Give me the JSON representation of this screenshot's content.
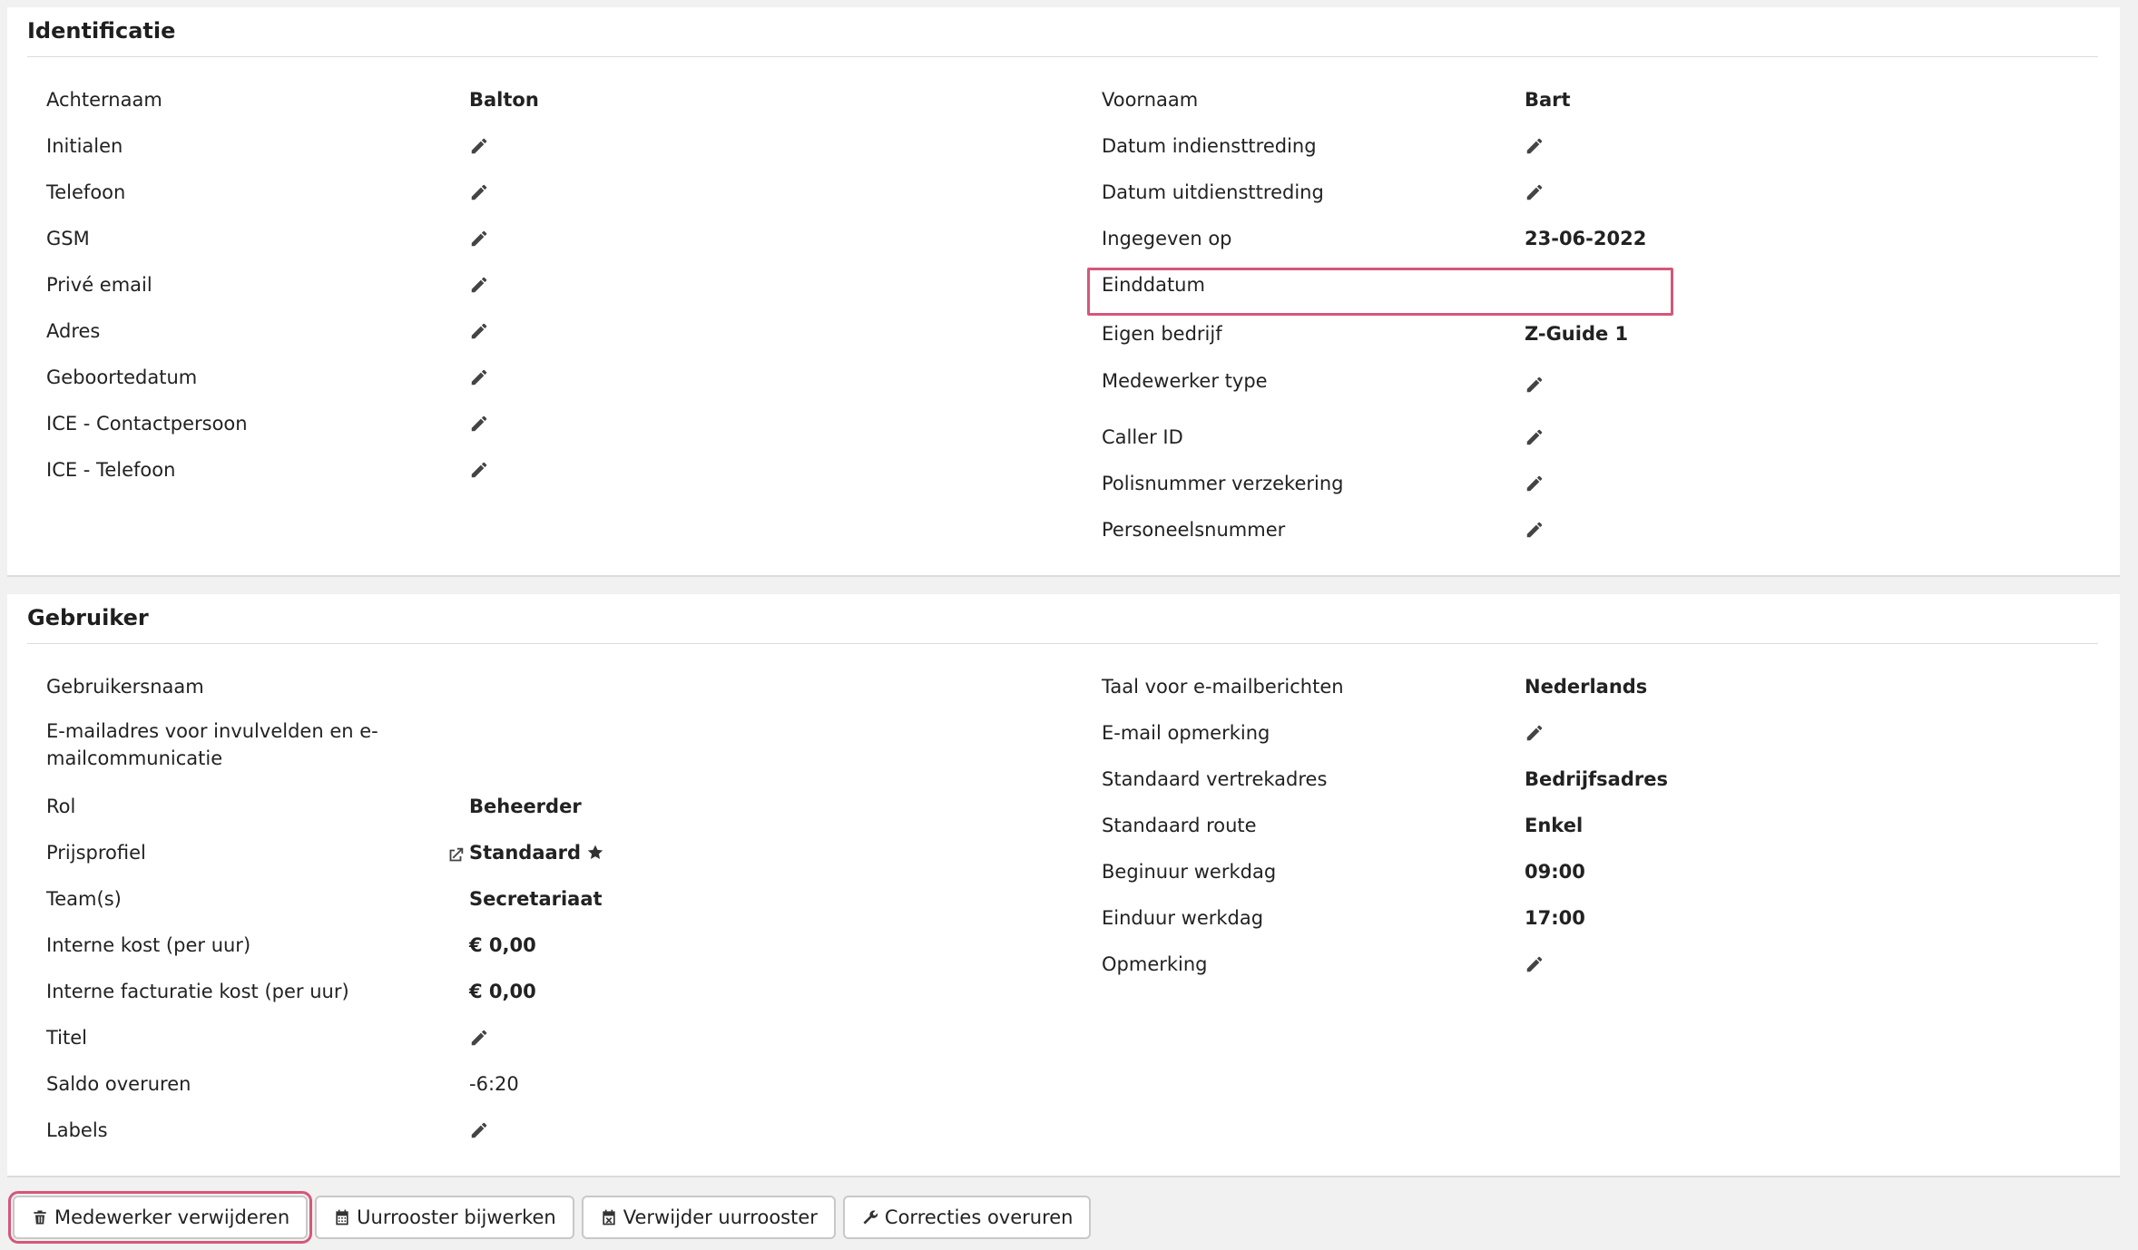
{
  "identificatie": {
    "title": "Identificatie",
    "left": [
      {
        "label": "Achternaam",
        "value": "Balton"
      },
      {
        "label": "Initialen",
        "value": ""
      },
      {
        "label": "Telefoon",
        "value": ""
      },
      {
        "label": "GSM",
        "value": ""
      },
      {
        "label": "Privé email",
        "value": ""
      },
      {
        "label": "Adres",
        "value": ""
      },
      {
        "label": "Geboortedatum",
        "value": ""
      },
      {
        "label": "ICE - Contactpersoon",
        "value": ""
      },
      {
        "label": "ICE - Telefoon",
        "value": ""
      }
    ],
    "right": [
      {
        "label": "Voornaam",
        "value": "Bart"
      },
      {
        "label": "Datum indiensttreding",
        "value": ""
      },
      {
        "label": "Datum uitdiensttreding",
        "value": ""
      },
      {
        "label": "Ingegeven op",
        "value": "23-06-2022"
      },
      {
        "label": "Einddatum",
        "value": ""
      },
      {
        "label": "Eigen bedrijf",
        "value": "Z-Guide 1"
      },
      {
        "label": "Medewerker type",
        "value": ""
      },
      {
        "label": "Caller ID",
        "value": ""
      },
      {
        "label": "Polisnummer verzekering",
        "value": ""
      },
      {
        "label": "Personeelsnummer",
        "value": ""
      }
    ]
  },
  "gebruiker": {
    "title": "Gebruiker",
    "left": [
      {
        "label": "Gebruikersnaam",
        "value": ""
      },
      {
        "label": "E-mailadres voor invulvelden en e-mailcommunicatie",
        "value": ""
      },
      {
        "label": "Rol",
        "value": "Beheerder"
      },
      {
        "label": "Prijsprofiel",
        "value": "Standaard"
      },
      {
        "label": "Team(s)",
        "value": "Secretariaat"
      },
      {
        "label": "Interne kost (per uur)",
        "value": "€ 0,00"
      },
      {
        "label": "Interne facturatie kost (per uur)",
        "value": "€ 0,00"
      },
      {
        "label": "Titel",
        "value": ""
      },
      {
        "label": "Saldo overuren",
        "value": "-6:20"
      },
      {
        "label": "Labels",
        "value": ""
      }
    ],
    "right": [
      {
        "label": "Taal voor e-mailberichten",
        "value": "Nederlands"
      },
      {
        "label": "E-mail opmerking",
        "value": ""
      },
      {
        "label": "Standaard vertrekadres",
        "value": "Bedrijfsadres"
      },
      {
        "label": "Standaard route",
        "value": "Enkel"
      },
      {
        "label": "Beginuur werkdag",
        "value": "09:00"
      },
      {
        "label": "Einduur werkdag",
        "value": "17:00"
      },
      {
        "label": "Opmerking",
        "value": ""
      }
    ]
  },
  "toolbar": {
    "delete_label": "Medewerker verwijderen",
    "update_schedule_label": "Uurrooster bijwerken",
    "remove_schedule_label": "Verwijder uurrooster",
    "overtime_corrections_label": "Correcties overuren"
  },
  "colors": {
    "highlight": "#d5577a",
    "card_background": "#ffffff",
    "page_background": "#f1f1f1"
  },
  "icons": {
    "edit": "pencil-icon",
    "external_link": "external-link-icon",
    "favorite": "star-icon",
    "delete": "trash-icon",
    "calendar": "calendar-icon",
    "calendar_remove": "calendar-x-icon",
    "wrench": "wrench-icon"
  }
}
